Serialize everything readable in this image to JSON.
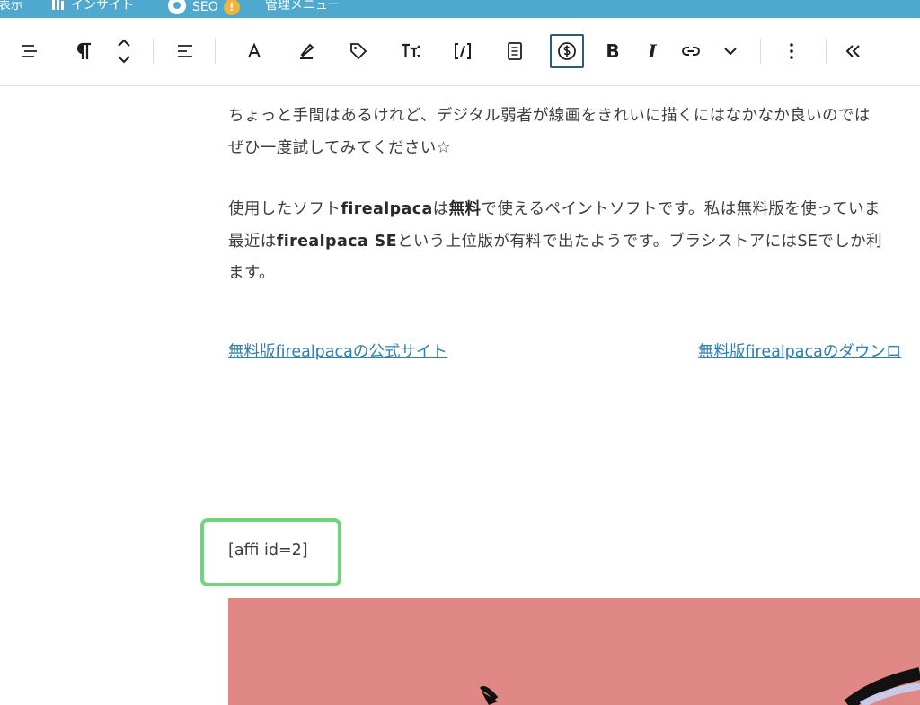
{
  "admin_bar": {
    "view_label": "表示",
    "insights_label": "インサイト",
    "seo_label": "SEO",
    "seo_badge": "!",
    "admin_menu_label": "管理メニュー",
    "background": "#4fa9cf"
  },
  "toolbar": {
    "active_button": "affiliate-block-button",
    "accent": "#2c5c76",
    "bold_label": "B",
    "italic_label": "I"
  },
  "content": {
    "p1_line1": "ちょっと手間はあるけれど、デジタル弱者が線画をきれいに描くにはなかなか良いのでは",
    "p1_line2": "ぜひ一度試してみてください☆",
    "p2_line1_a": "使用したソフト",
    "p2_line1_b": "firealpaca",
    "p2_line1_c": "は",
    "p2_line1_d": "無料",
    "p2_line1_e": "で使えるペイントソフトです。私は無料版を使っていま",
    "p2_line2_a": "最近は",
    "p2_line2_b": "firealpaca SE",
    "p2_line2_c": "という上位版が有料で出たようです。ブラシストアにはSEでしか利",
    "p2_line3": "ます。",
    "link1": "無料版firealpacaの公式サイト",
    "link2": "無料版firealpacaのダウンロ",
    "shortcode": "[affi id=2]",
    "highlight_color": "#72d47a",
    "image_background": "#df8885"
  }
}
